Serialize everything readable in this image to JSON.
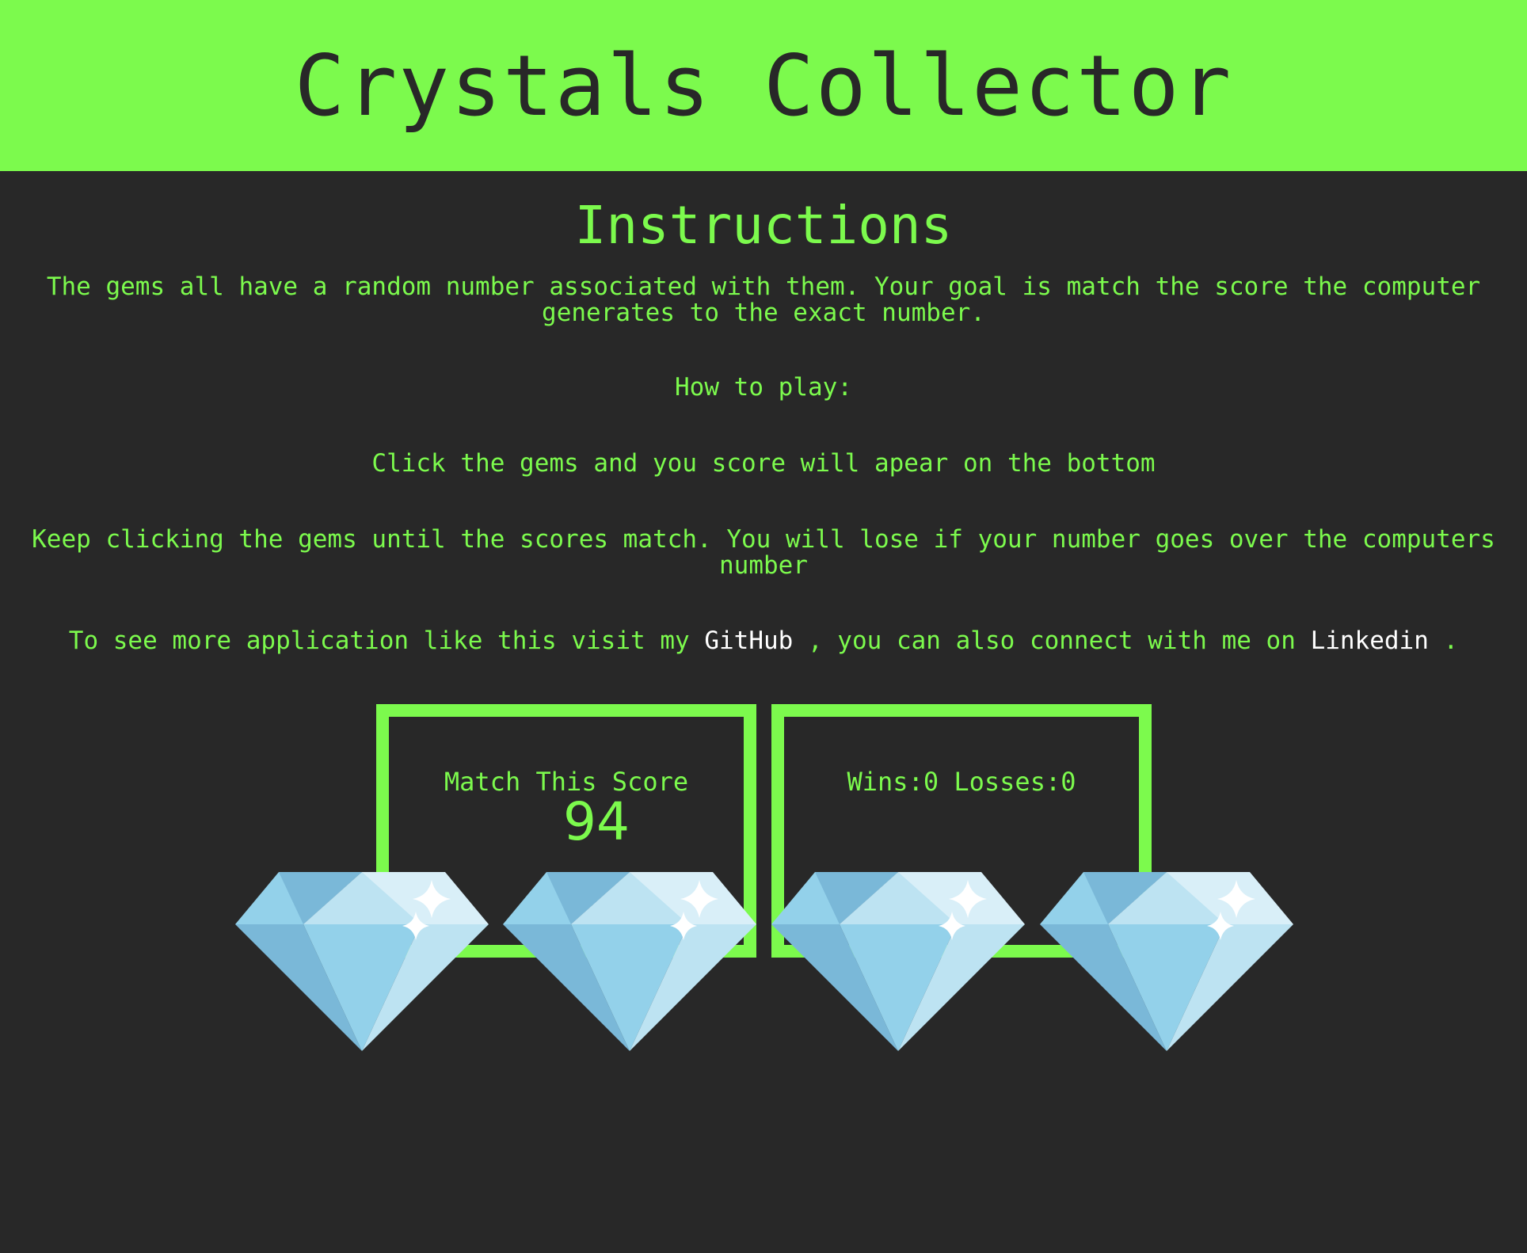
{
  "header": {
    "title": "Crystals Collector"
  },
  "instructions": {
    "title": "Instructions",
    "intro": "The gems all have a random number associated with them. Your goal is match the score the computer generates to the exact number.",
    "how_to_play": "How to play:",
    "step_click": "Click the gems and you score will apear on the bottom",
    "step_keep": "Keep clicking the gems until the scores match. You will lose if your number goes over the computers number",
    "links_prefix": "To see more application like this visit my",
    "github_label": "GitHub",
    "links_middle": ", you can also connect with me on",
    "linkedin_label": "Linkedin",
    "links_suffix": "."
  },
  "scoreboard": {
    "target_label": "Match This Score",
    "target_value": "94",
    "record_label": "Wins:0 Losses:0"
  },
  "gems": [
    {
      "icon": "diamond-icon"
    },
    {
      "icon": "diamond-icon"
    },
    {
      "icon": "diamond-icon"
    },
    {
      "icon": "diamond-icon"
    }
  ],
  "colors": {
    "accent": "#7cfa4d",
    "background": "#282828",
    "link": "#ffffff",
    "gem_light": "#bde3f2",
    "gem_mid": "#93d1ea",
    "gem_dark": "#7ab8d8"
  }
}
